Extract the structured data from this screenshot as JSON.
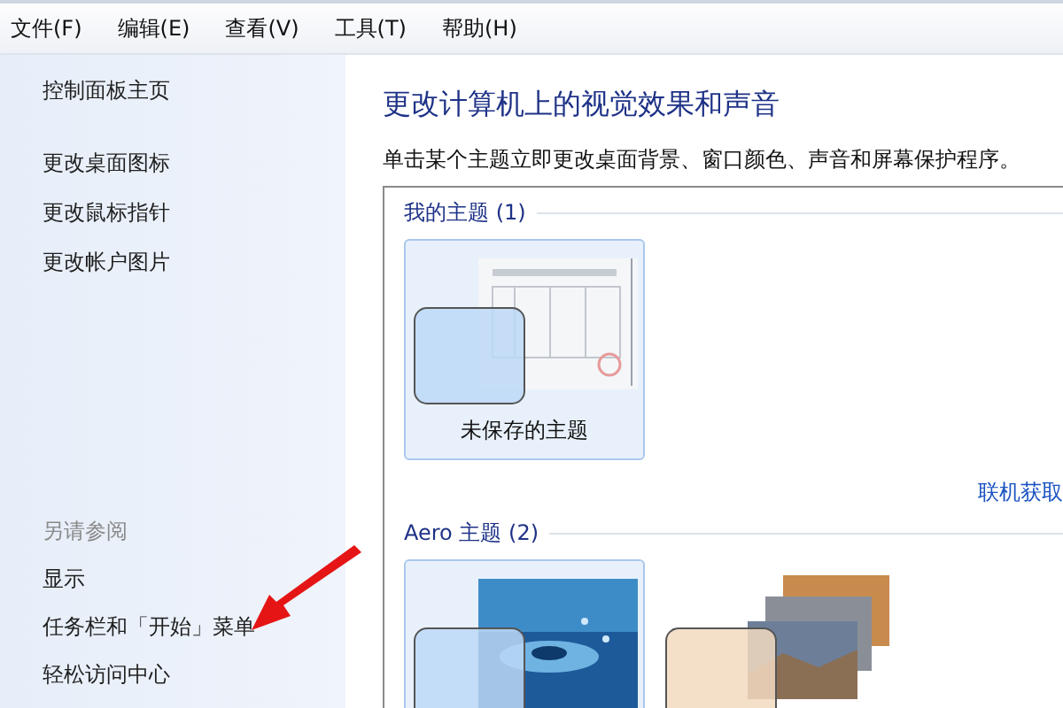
{
  "menu": [
    "文件(F)",
    "编辑(E)",
    "查看(V)",
    "工具(T)",
    "帮助(H)"
  ],
  "sidebar": {
    "links": [
      "控制面板主页",
      "更改桌面图标",
      "更改鼠标指针",
      "更改帐户图片"
    ],
    "see_also_title": "另请参阅",
    "see_also": [
      "显示",
      "任务栏和「开始」菜单",
      "轻松访问中心"
    ]
  },
  "heading": "更改计算机上的视觉效果和声音",
  "description": "单击某个主题立即更改桌面背景、窗口颜色、声音和屏幕保护程序。",
  "groups": [
    {
      "title": "我的主题 (1)",
      "themes": [
        {
          "kind": "document",
          "label": "未保存的主题",
          "highlighted": true
        }
      ],
      "link": "联机获取"
    },
    {
      "title": "Aero 主题 (2)",
      "themes": [
        {
          "kind": "water",
          "highlighted": true
        },
        {
          "kind": "stack",
          "highlighted": false
        }
      ]
    }
  ]
}
